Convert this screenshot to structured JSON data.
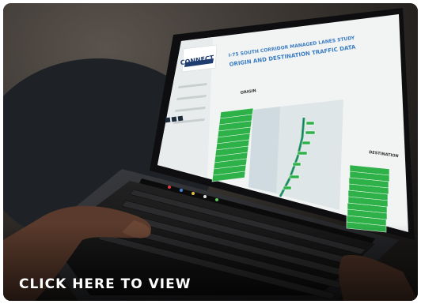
{
  "cta_label": "CLICK HERE TO VIEW",
  "screen": {
    "logo_text": "CONNECT",
    "title_line1": "I-75 SOUTH CORRIDOR MANAGED LANES STUDY",
    "title_line2": "ORIGIN AND DESTINATION TRAFFIC DATA",
    "origin_label": "ORIGIN",
    "destination_label": "DESTINATION"
  },
  "colors": {
    "accent_green": "#2fb14a",
    "title_blue": "#3a7cc2",
    "text_white": "#ffffff"
  }
}
